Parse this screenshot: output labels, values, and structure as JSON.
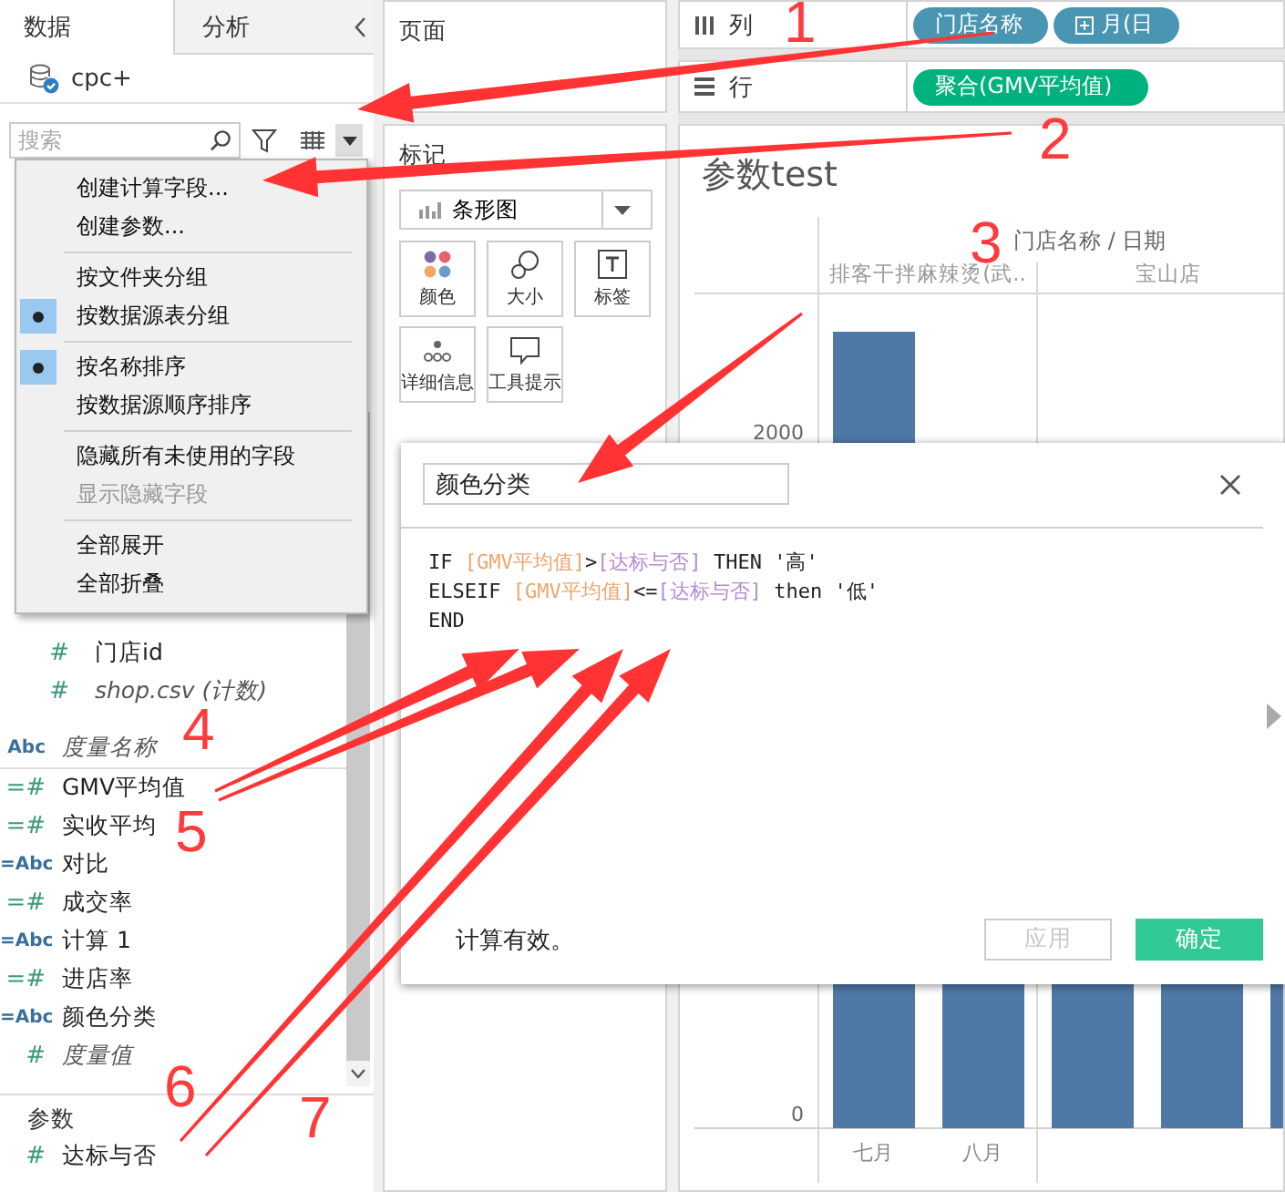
{
  "left_panel": {
    "tabs": [
      {
        "label": "数据",
        "selected": true
      },
      {
        "label": "分析",
        "selected": false
      }
    ],
    "datasource": {
      "name": "cpc+"
    },
    "search": {
      "placeholder": "搜索"
    },
    "field_sections": [
      {
        "kind": "table",
        "items": [
          {
            "label": "门店id",
            "icon": "#",
            "continuous": true,
            "italic": false
          },
          {
            "label": "shop.csv (计数)",
            "icon": "#",
            "continuous": true,
            "italic": true
          }
        ]
      },
      {
        "kind": "dimensions",
        "items": [
          {
            "label": "度量名称",
            "icon": "Abc",
            "continuous": false,
            "italic": true
          }
        ]
      },
      {
        "kind": "measures",
        "items": [
          {
            "label": "GMV平均值",
            "icon": "=#",
            "continuous": true,
            "italic": false
          },
          {
            "label": "实收平均",
            "icon": "=#",
            "continuous": true,
            "italic": false
          },
          {
            "label": "对比",
            "icon": "=Abc",
            "continuous": false,
            "italic": false
          },
          {
            "label": "成交率",
            "icon": "=#",
            "continuous": true,
            "italic": false
          },
          {
            "label": "计算 1",
            "icon": "=Abc",
            "continuous": false,
            "italic": false
          },
          {
            "label": "进店率",
            "icon": "=#",
            "continuous": true,
            "italic": false
          },
          {
            "label": "颜色分类",
            "icon": "=Abc",
            "continuous": false,
            "italic": false
          },
          {
            "label": "度量值",
            "icon": "#",
            "continuous": true,
            "italic": true
          }
        ]
      }
    ],
    "parameters": {
      "title": "参数",
      "items": [
        {
          "label": "达标与否",
          "icon": "#",
          "continuous": true,
          "italic": false
        }
      ]
    }
  },
  "menu": {
    "sections": [
      {
        "items": [
          {
            "label": "创建计算字段...",
            "disabled": false
          },
          {
            "label": "创建参数...",
            "disabled": false
          }
        ]
      },
      {
        "items": [
          {
            "label": "按文件夹分组",
            "selected": false,
            "disabled": false
          },
          {
            "label": "按数据源表分组",
            "selected": true,
            "disabled": false
          }
        ]
      },
      {
        "items": [
          {
            "label": "按名称排序",
            "selected": true,
            "disabled": false
          },
          {
            "label": "按数据源顺序排序",
            "selected": false,
            "disabled": false
          }
        ]
      },
      {
        "items": [
          {
            "label": "隐藏所有未使用的字段",
            "disabled": false
          },
          {
            "label": "显示隐藏字段",
            "disabled": true
          }
        ]
      },
      {
        "items": [
          {
            "label": "全部展开",
            "disabled": false
          },
          {
            "label": "全部折叠",
            "disabled": false
          }
        ]
      }
    ]
  },
  "pages_shelf": {
    "title": "页面"
  },
  "marks": {
    "title": "标记",
    "mark_type": "条形图",
    "buttons": [
      {
        "kind": "color",
        "label": "颜色"
      },
      {
        "kind": "size",
        "label": "大小"
      },
      {
        "kind": "label",
        "label": "标签"
      },
      {
        "kind": "detail",
        "label": "详细信息"
      },
      {
        "kind": "tooltip",
        "label": "工具提示"
      }
    ]
  },
  "columns_shelf": {
    "title": "列",
    "pills": [
      {
        "label": "门店名称",
        "kind": "dimension"
      },
      {
        "label": "月(日",
        "kind": "date"
      }
    ]
  },
  "rows_shelf": {
    "title": "行",
    "pills": [
      {
        "label": "聚合(GMV平均值)",
        "kind": "measure"
      }
    ]
  },
  "view": {
    "title": "参数test",
    "header": "门店名称 / 日期",
    "column_headers": [
      "排客干拌麻辣烫(武..",
      "宝山店"
    ],
    "y_ticks": [
      "2000",
      "0"
    ],
    "x_labels": [
      "七月",
      "八月"
    ]
  },
  "dialog": {
    "name": "颜色分类",
    "code": [
      [
        {
          "kind": "keyword",
          "text": "IF "
        },
        {
          "kind": "field",
          "text": "[GMV平均值]"
        },
        {
          "kind": "operator",
          "text": ">"
        },
        {
          "kind": "parameter",
          "text": "[达标与否]"
        },
        {
          "kind": "keyword",
          "text": " THEN "
        },
        {
          "kind": "string",
          "text": "'高'"
        }
      ],
      [
        {
          "kind": "keyword",
          "text": "ELSEIF "
        },
        {
          "kind": "field",
          "text": "[GMV平均值]"
        },
        {
          "kind": "operator",
          "text": "<="
        },
        {
          "kind": "parameter",
          "text": "[达标与否]"
        },
        {
          "kind": "keyword",
          "text": " then "
        },
        {
          "kind": "string",
          "text": "'低'"
        }
      ],
      [
        {
          "kind": "keyword",
          "text": "END"
        }
      ]
    ],
    "status": "计算有效。",
    "buttons": [
      {
        "label": "应用",
        "kind": "secondary",
        "disabled": true
      },
      {
        "label": "确定",
        "kind": "primary",
        "disabled": false
      }
    ]
  },
  "annotations": [
    {
      "text": "1"
    },
    {
      "text": "2"
    },
    {
      "text": "3"
    },
    {
      "text": "4"
    },
    {
      "text": "5"
    },
    {
      "text": "6"
    },
    {
      "text": "7"
    }
  ]
}
